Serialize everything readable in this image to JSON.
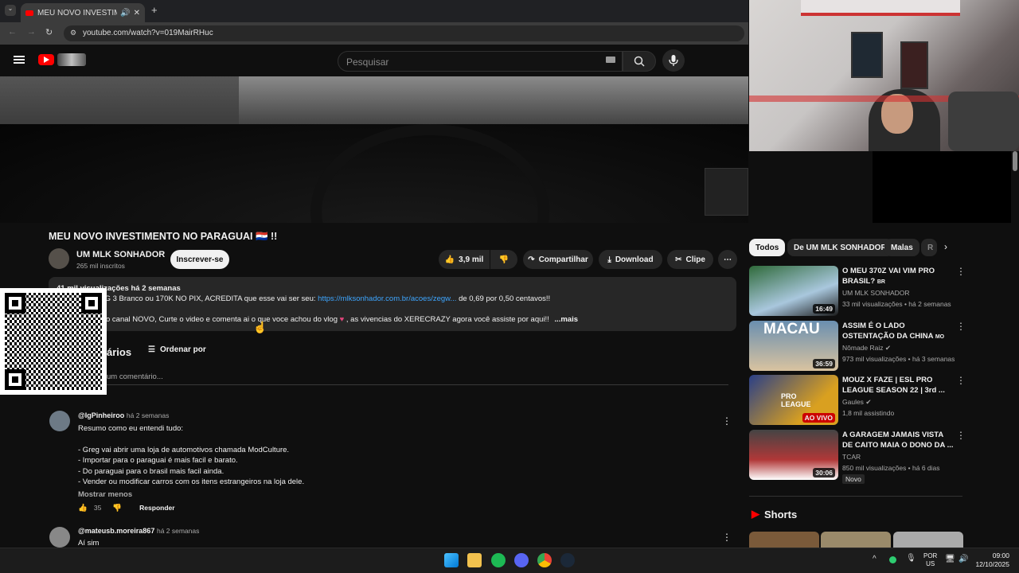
{
  "browser": {
    "tab_title": "MEU NOVO INVESTIMENTO",
    "url": "youtube.com/watch?v=019MairRHuc"
  },
  "header": {
    "search_placeholder": "Pesquisar"
  },
  "video": {
    "title": "MEU NOVO INVESTIMENTO NO PARAGUAI 🇵🇾 !!",
    "channel": "UM MLK SONHADOR",
    "subscribers": "265 mil inscritos",
    "subscribe_label": "Inscrever-se",
    "likes": "3,9 mil",
    "share_label": "Compartilhar",
    "download_label": "Download",
    "clip_label": "Clipe"
  },
  "description": {
    "meta": "41 mil visualizações  há 2 semanas",
    "line1_prefix": "GTI STG 3 Branco ou 170K NO PIX, ACREDITA que esse vai ser seu:",
    "line1_link": "https://mlksonhador.com.br/acoes/zegw...",
    "line1_suffix": "de 0,69 por 0,50 centavos!!",
    "line2": "o canal NOVO, Curte o video e comenta ai o que voce achou do vlog",
    "line2_suffix": ", as vivencias do XERECRAZY agora você assiste por aqui!!",
    "more": "...mais"
  },
  "comments_section": {
    "title_partial": "ários",
    "sort_label": "Ordenar por",
    "add_placeholder": "um comentário..."
  },
  "comments": [
    {
      "author": "@IgPinheiroo",
      "time": "há 2 semanas",
      "lines": [
        "Resumo como eu entendi tudo:",
        "",
        "- Greg vai abrir uma loja de automotivos chamada ModCulture.",
        "- Importar para o paraguai é mais facil e barato.",
        "- Do paraguai para o brasil mais facil ainda.",
        "- Vender ou modificar carros com os itens estrangeiros na loja dele."
      ],
      "show_less": "Mostrar menos",
      "likes": "35",
      "reply": "Responder"
    },
    {
      "author": "@mateusb.moreira867",
      "time": "há 2 semanas",
      "lines": [
        "Aí sim"
      ]
    }
  ],
  "chips": [
    "Todos",
    "De UM MLK SONHADOR",
    "Malas",
    "R"
  ],
  "recommendations": [
    {
      "title": "O MEU 370Z VAI VIM PRO BRASIL?",
      "badge": "BR",
      "channel": "UM MLK SONHADOR",
      "views": "33 mil visualizações • há 2 semanas",
      "duration": "16:49",
      "thumb_color": "#2f6a3a"
    },
    {
      "title": "ASSIM É O LADO OSTENTAÇÃO DA CHINA",
      "badge": "MO",
      "channel": "Nômade Raiz",
      "views": "973 mil visualizações • há 3 semanas",
      "duration": "36:59",
      "thumb_color": "#6a8fb0",
      "overlay": "MACAU"
    },
    {
      "title": "MOUZ X FAZE | ESL PRO LEAGUE SEASON 22 | 3rd ...",
      "channel": "Gaules",
      "views": "1,8 mil assistindo",
      "duration": "AO VIVO",
      "thumb_color": "#d9a020",
      "overlay": "PRO LEAGUE"
    },
    {
      "title": "A GARAGEM JAMAIS VISTA DE CAITO MAIA O DONO DA ...",
      "channel": "TCAR",
      "views": "850 mil visualizações • há 6 dias",
      "duration": "30:06",
      "thumb_color": "#b13838",
      "badge2": "Novo"
    }
  ],
  "shorts_label": "Shorts",
  "taskbar": {
    "lang": "POR",
    "region": "US",
    "time": "09:00",
    "date": "12/10/2025"
  }
}
